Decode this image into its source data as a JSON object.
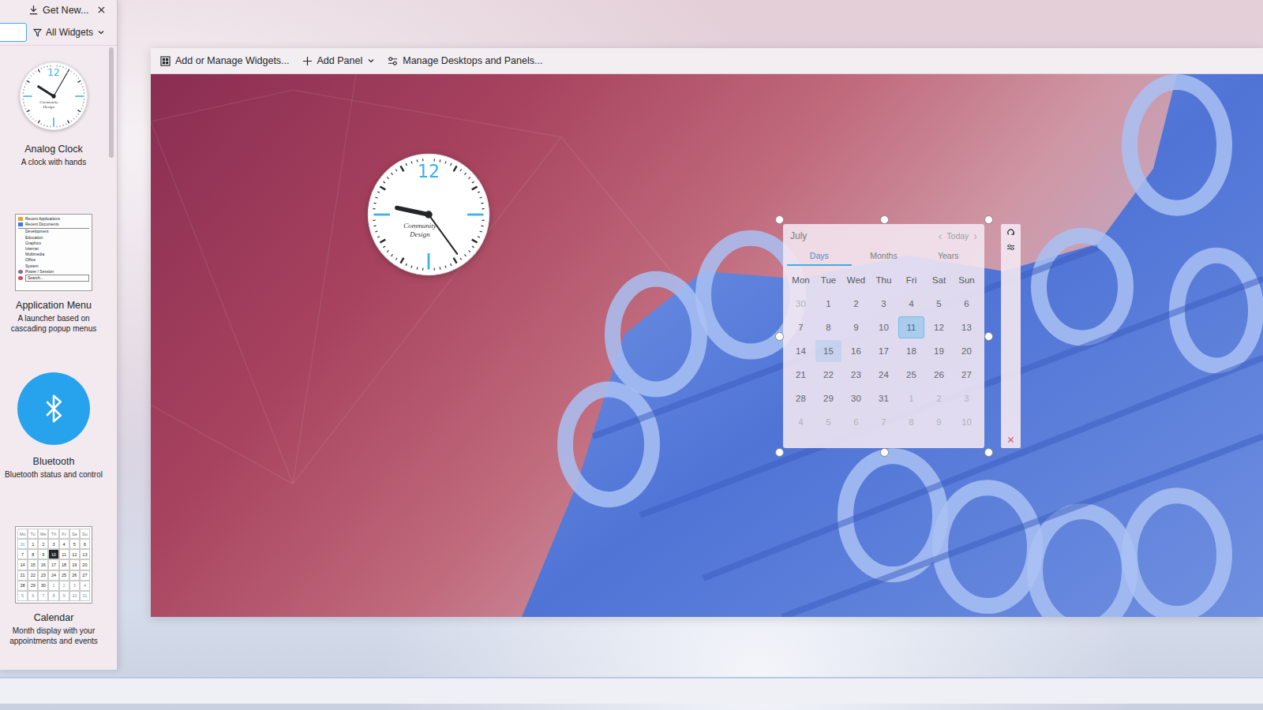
{
  "widget_explorer": {
    "get_new": "Get New...",
    "filter": "All Widgets",
    "widgets": [
      {
        "name": "Analog Clock",
        "description": "A clock with hands",
        "kind": "clock",
        "preview": {
          "numeral": "12",
          "brand": "Community Design",
          "time": {
            "hour": 10,
            "minute": 5
          }
        }
      },
      {
        "name": "Application Menu",
        "description": "A launcher based on cascading popup menus",
        "kind": "menu",
        "preview": {
          "entries": [
            "Recent Applications",
            "Recent Documents",
            "Development",
            "Education",
            "Graphics",
            "Internet",
            "Multimedia",
            "Office",
            "System",
            "Power / Session"
          ],
          "search": "Search..."
        }
      },
      {
        "name": "Bluetooth",
        "description": "Bluetooth status and control",
        "kind": "bluetooth",
        "preview": {}
      },
      {
        "name": "Calendar",
        "description": "Month display with your appointments and events",
        "kind": "calendar",
        "preview": {
          "headers": [
            "Mo",
            "Tu",
            "We",
            "Th",
            "Fr",
            "Sa",
            "Su"
          ],
          "weeks": [
            [
              {
                "d": "31",
                "dim": true,
                "today": false
              },
              {
                "d": "1",
                "dim": false,
                "today": false
              },
              {
                "d": "2",
                "dim": false,
                "today": false
              },
              {
                "d": "3",
                "dim": false,
                "today": false
              },
              {
                "d": "4",
                "dim": false,
                "today": false
              },
              {
                "d": "5",
                "dim": false,
                "today": false
              },
              {
                "d": "6",
                "dim": false,
                "today": false
              }
            ],
            [
              {
                "d": "7",
                "dim": false,
                "today": false
              },
              {
                "d": "8",
                "dim": false,
                "today": false
              },
              {
                "d": "9",
                "dim": false,
                "today": false
              },
              {
                "d": "10",
                "dim": false,
                "today": true
              },
              {
                "d": "11",
                "dim": false,
                "today": false
              },
              {
                "d": "12",
                "dim": false,
                "today": false
              },
              {
                "d": "13",
                "dim": false,
                "today": false
              }
            ],
            [
              {
                "d": "14",
                "dim": false,
                "today": false
              },
              {
                "d": "15",
                "dim": false,
                "today": false
              },
              {
                "d": "16",
                "dim": false,
                "today": false
              },
              {
                "d": "17",
                "dim": false,
                "today": false
              },
              {
                "d": "18",
                "dim": false,
                "today": false
              },
              {
                "d": "19",
                "dim": false,
                "today": false
              },
              {
                "d": "20",
                "dim": false,
                "today": false
              }
            ],
            [
              {
                "d": "21",
                "dim": false,
                "today": false
              },
              {
                "d": "22",
                "dim": false,
                "today": false
              },
              {
                "d": "23",
                "dim": false,
                "today": false
              },
              {
                "d": "24",
                "dim": false,
                "today": false
              },
              {
                "d": "25",
                "dim": false,
                "today": false
              },
              {
                "d": "26",
                "dim": false,
                "today": false
              },
              {
                "d": "27",
                "dim": false,
                "today": false
              }
            ],
            [
              {
                "d": "28",
                "dim": false,
                "today": false
              },
              {
                "d": "29",
                "dim": false,
                "today": false
              },
              {
                "d": "30",
                "dim": false,
                "today": false
              },
              {
                "d": "1",
                "dim": true,
                "today": false
              },
              {
                "d": "2",
                "dim": true,
                "today": false
              },
              {
                "d": "3",
                "dim": true,
                "today": false
              },
              {
                "d": "4",
                "dim": true,
                "today": false
              }
            ],
            [
              {
                "d": "5",
                "dim": true,
                "today": false
              },
              {
                "d": "6",
                "dim": true,
                "today": false
              },
              {
                "d": "7",
                "dim": true,
                "today": false
              },
              {
                "d": "8",
                "dim": true,
                "today": false
              },
              {
                "d": "9",
                "dim": true,
                "today": false
              },
              {
                "d": "10",
                "dim": true,
                "today": false
              },
              {
                "d": "11",
                "dim": true,
                "today": false
              }
            ]
          ]
        }
      }
    ]
  },
  "toolbar": [
    {
      "label": "Add or Manage Widgets...",
      "kind": "widgets",
      "dropdown": false
    },
    {
      "label": "Add Panel",
      "kind": "add",
      "dropdown": true
    },
    {
      "label": "Manage Desktops and Panels...",
      "kind": "manage",
      "dropdown": false
    }
  ],
  "desktop": {
    "clock": {
      "numeral": "12",
      "brand": "Community Design",
      "time": {
        "hour": 9,
        "minute": 24
      }
    },
    "calendar": {
      "month": "July",
      "today_button": "Today",
      "prev": "‹",
      "next": "›",
      "tabs": [
        {
          "label": "Days",
          "selected": true
        },
        {
          "label": "Months",
          "selected": false
        },
        {
          "label": "Years",
          "selected": false
        }
      ],
      "weekdays": [
        "Mon",
        "Tue",
        "Wed",
        "Thu",
        "Fri",
        "Sat",
        "Sun"
      ],
      "weeks": [
        [
          {
            "day": "30",
            "current_month": false,
            "today": false,
            "hovered": false
          },
          {
            "day": "1",
            "current_month": true,
            "today": false,
            "hovered": false
          },
          {
            "day": "2",
            "current_month": true,
            "today": false,
            "hovered": false
          },
          {
            "day": "3",
            "current_month": true,
            "today": false,
            "hovered": false
          },
          {
            "day": "4",
            "current_month": true,
            "today": false,
            "hovered": false
          },
          {
            "day": "5",
            "current_month": true,
            "today": false,
            "hovered": false
          },
          {
            "day": "6",
            "current_month": true,
            "today": false,
            "hovered": false
          }
        ],
        [
          {
            "day": "7",
            "current_month": true,
            "today": false,
            "hovered": false
          },
          {
            "day": "8",
            "current_month": true,
            "today": false,
            "hovered": false
          },
          {
            "day": "9",
            "current_month": true,
            "today": false,
            "hovered": false
          },
          {
            "day": "10",
            "current_month": true,
            "today": false,
            "hovered": false
          },
          {
            "day": "11",
            "current_month": true,
            "today": true,
            "hovered": false
          },
          {
            "day": "12",
            "current_month": true,
            "today": false,
            "hovered": false
          },
          {
            "day": "13",
            "current_month": true,
            "today": false,
            "hovered": false
          }
        ],
        [
          {
            "day": "14",
            "current_month": true,
            "today": false,
            "hovered": false
          },
          {
            "day": "15",
            "current_month": true,
            "today": false,
            "hovered": true
          },
          {
            "day": "16",
            "current_month": true,
            "today": false,
            "hovered": false
          },
          {
            "day": "17",
            "current_month": true,
            "today": false,
            "hovered": false
          },
          {
            "day": "18",
            "current_month": true,
            "today": false,
            "hovered": false
          },
          {
            "day": "19",
            "current_month": true,
            "today": false,
            "hovered": false
          },
          {
            "day": "20",
            "current_month": true,
            "today": false,
            "hovered": false
          }
        ],
        [
          {
            "day": "21",
            "current_month": true,
            "today": false,
            "hovered": false
          },
          {
            "day": "22",
            "current_month": true,
            "today": false,
            "hovered": false
          },
          {
            "day": "23",
            "current_month": true,
            "today": false,
            "hovered": false
          },
          {
            "day": "24",
            "current_month": true,
            "today": false,
            "hovered": false
          },
          {
            "day": "25",
            "current_month": true,
            "today": false,
            "hovered": false
          },
          {
            "day": "26",
            "current_month": true,
            "today": false,
            "hovered": false
          },
          {
            "day": "27",
            "current_month": true,
            "today": false,
            "hovered": false
          }
        ],
        [
          {
            "day": "28",
            "current_month": true,
            "today": false,
            "hovered": false
          },
          {
            "day": "29",
            "current_month": true,
            "today": false,
            "hovered": false
          },
          {
            "day": "30",
            "current_month": true,
            "today": false,
            "hovered": false
          },
          {
            "day": "31",
            "current_month": true,
            "today": false,
            "hovered": false
          },
          {
            "day": "1",
            "current_month": false,
            "today": false,
            "hovered": false
          },
          {
            "day": "2",
            "current_month": false,
            "today": false,
            "hovered": false
          },
          {
            "day": "3",
            "current_month": false,
            "today": false,
            "hovered": false
          }
        ],
        [
          {
            "day": "4",
            "current_month": false,
            "today": false,
            "hovered": false
          },
          {
            "day": "5",
            "current_month": false,
            "today": false,
            "hovered": false
          },
          {
            "day": "6",
            "current_month": false,
            "today": false,
            "hovered": false
          },
          {
            "day": "7",
            "current_month": false,
            "today": false,
            "hovered": false
          },
          {
            "day": "8",
            "current_month": false,
            "today": false,
            "hovered": false
          },
          {
            "day": "9",
            "current_month": false,
            "today": false,
            "hovered": false
          },
          {
            "day": "10",
            "current_month": false,
            "today": false,
            "hovered": false
          }
        ]
      ]
    }
  }
}
